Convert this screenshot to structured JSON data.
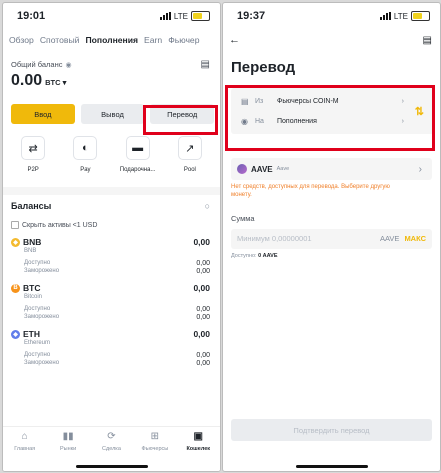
{
  "left": {
    "status": {
      "time": "19:01",
      "network": "LTE"
    },
    "tabs": [
      "Обзор",
      "Спотовый",
      "Пополнения",
      "Earn",
      "Фьючер"
    ],
    "balance_label": "Общий баланс",
    "balance_value": "0.00",
    "balance_currency": "BTC ▾",
    "actions": {
      "deposit": "Ввод",
      "withdraw": "Вывод",
      "transfer": "Перевод"
    },
    "quick": [
      {
        "label": "P2P",
        "icon": "p2p-icon"
      },
      {
        "label": "Pay",
        "icon": "pay-icon"
      },
      {
        "label": "Подарочна...",
        "icon": "gift-card-icon"
      },
      {
        "label": "Pool",
        "icon": "pool-icon"
      }
    ],
    "balances_title": "Балансы",
    "hide_small": "Скрыть активы <1 USD",
    "assets": [
      {
        "symbol": "BNB",
        "name": "BNB",
        "total": "0,00",
        "available_label": "Доступно",
        "available": "0,00",
        "frozen_label": "Заморожено",
        "frozen": "0,00",
        "color": "#f3ba2f",
        "glyph": "◆"
      },
      {
        "symbol": "BTC",
        "name": "Bitcoin",
        "total": "0,00",
        "available_label": "Доступно",
        "available": "0,00",
        "frozen_label": "Заморожено",
        "frozen": "0,00",
        "color": "#f7931a",
        "glyph": "B"
      },
      {
        "symbol": "ETH",
        "name": "Ethereum",
        "total": "0,00",
        "available_label": "Доступно",
        "available": "0,00",
        "frozen_label": "Заморожено",
        "frozen": "0,00",
        "color": "#627eea",
        "glyph": "◆"
      }
    ],
    "nav": [
      {
        "label": "Главная",
        "icon": "home-icon",
        "active": false
      },
      {
        "label": "Рынки",
        "icon": "markets-icon",
        "active": false
      },
      {
        "label": "Сделка",
        "icon": "trade-icon",
        "active": false
      },
      {
        "label": "Фьючерсы",
        "icon": "futures-icon",
        "active": false
      },
      {
        "label": "Кошелек",
        "icon": "wallet-icon",
        "active": true
      }
    ]
  },
  "right": {
    "status": {
      "time": "19:37",
      "network": "LTE"
    },
    "title": "Перевод",
    "from_label": "Из",
    "from_value": "Фьючерсы COIN-M",
    "to_label": "На",
    "to_value": "Пополнения",
    "coin": "AAVE",
    "coin_sub": "Aave",
    "warning": "Нет средств, доступных для перевода. Выберите другую монету.",
    "amount_label": "Сумма",
    "amount_placeholder": "Минимум 0,00000001",
    "amount_currency": "AAVE",
    "max_label": "МАКС",
    "available_label": "Доступно:",
    "available_value": "0 AAVE",
    "confirm_label": "Подтвердить перевод"
  },
  "colors": {
    "accent": "#f0b90b",
    "highlight": "#e0001b",
    "warning": "#f0802b"
  }
}
